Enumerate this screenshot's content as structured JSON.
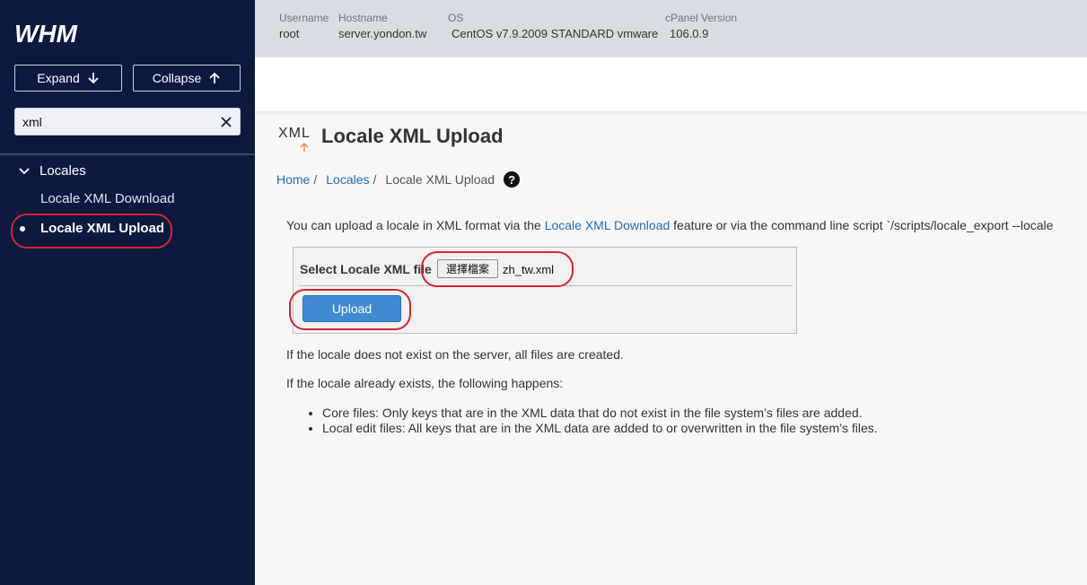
{
  "sidebar": {
    "logo": "WHM",
    "expand_label": "Expand",
    "collapse_label": "Collapse",
    "search_value": "xml",
    "group_label": "Locales",
    "items": [
      {
        "label": "Locale XML Download"
      },
      {
        "label": "Locale XML Upload"
      }
    ]
  },
  "topbar": {
    "username_label": "Username",
    "username": "root",
    "hostname_label": "Hostname",
    "hostname": "server.yondon.tw",
    "os_label": "OS",
    "os": "CentOS v7.9.2009 STANDARD vmware",
    "cpanel_label": "cPanel Version",
    "cpanel": "106.0.9"
  },
  "page": {
    "icon_text": "XML",
    "title": "Locale XML Upload",
    "breadcrumb": {
      "home": "Home",
      "sep1": "/",
      "locales": "Locales",
      "sep2": "/",
      "current": "Locale XML Upload"
    },
    "intro_before": "You can upload a locale in XML format via the ",
    "intro_link": "Locale XML Download",
    "intro_after": " feature or via the command line script `/scripts/locale_export --locale",
    "form": {
      "label": "Select Locale XML file",
      "file_button": "選擇檔案",
      "file_name": "zh_tw.xml",
      "upload_label": "Upload"
    },
    "note1": "If the locale does not exist on the server, all files are created.",
    "note2": "If the locale already exists, the following happens:",
    "bullets": [
      "Core files: Only keys that are in the XML data that do not exist in the file system’s files are added.",
      "Local edit files: All keys that are in the XML data are added to or overwritten in the file system’s files."
    ]
  },
  "colors": {
    "sidebar_bg": "#0c1a3f",
    "link": "#1f6fb0",
    "upload_button": "#3f8ad2",
    "highlight": "#d9232e"
  }
}
